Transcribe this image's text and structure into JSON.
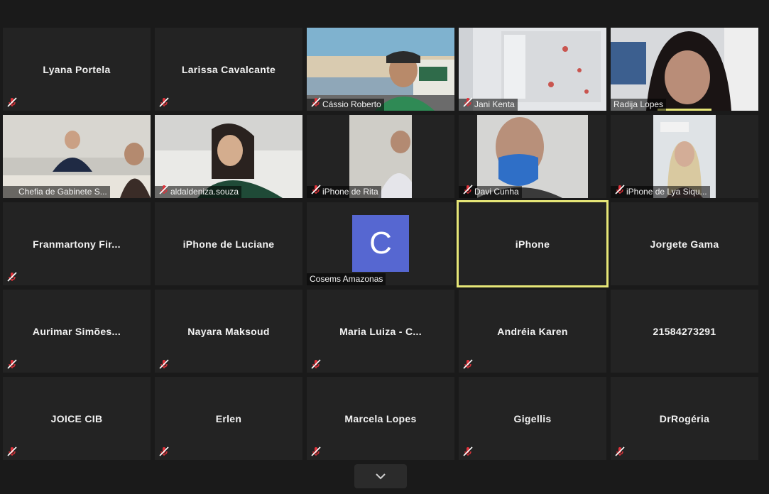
{
  "participants": {
    "lyana": "Lyana Portela",
    "larissa": "Larissa Cavalcante",
    "cassio": "Cássio Roberto",
    "jani": "Jani Kenta",
    "radija": "Radija Lopes",
    "chefia": "Chefia de Gabinete S...",
    "aldaldeniza": "aldaldeniza.souza",
    "rita": "iPhone de Rita",
    "davi": "Davi Cunha",
    "lya": "iPhone de Lya Siqu...",
    "franmartony": "Franmartony  Fir...",
    "luciane": "iPhone de Luciane",
    "cosems": "Cosems Amazonas",
    "cosems_initial": "C",
    "iphone": "iPhone",
    "jorgete": "Jorgete Gama",
    "aurimar": "Aurimar  Simões...",
    "nayara": "Nayara Maksoud",
    "maria": "Maria  Luiza  -  C...",
    "andreia": "Andréia Karen",
    "phone": "21584273291",
    "joice": "JOICE CIB",
    "erlen": "Erlen",
    "marcela": "Marcela Lopes",
    "gigellis": "Gigellis",
    "drrogeria": "DrRogéria"
  },
  "colors": {
    "active_speaker": "#e6e677",
    "avatar_bg": "#5667d1",
    "mute_red": "#e0323a"
  }
}
